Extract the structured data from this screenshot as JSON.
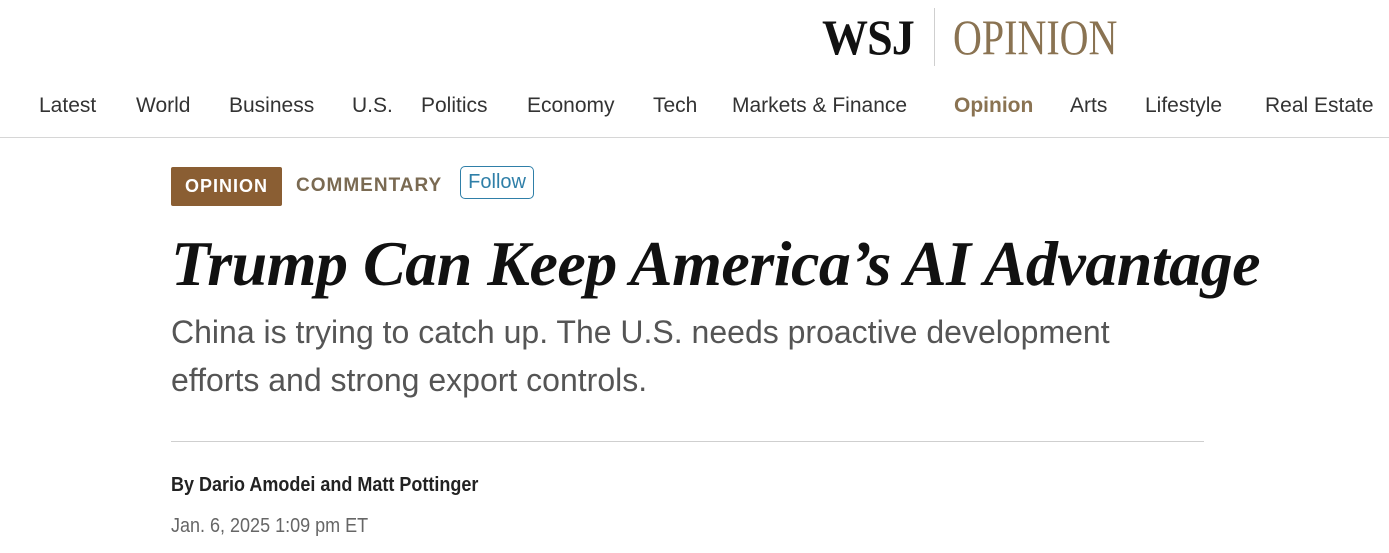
{
  "masthead": {
    "brand": "WSJ",
    "section": "OPINION"
  },
  "nav": {
    "items": [
      {
        "label": "Latest"
      },
      {
        "label": "World"
      },
      {
        "label": "Business"
      },
      {
        "label": "U.S."
      },
      {
        "label": "Politics"
      },
      {
        "label": "Economy"
      },
      {
        "label": "Tech"
      },
      {
        "label": "Markets & Finance"
      },
      {
        "label": "Opinion",
        "active": true
      },
      {
        "label": "Arts"
      },
      {
        "label": "Lifestyle"
      },
      {
        "label": "Real Estate"
      }
    ]
  },
  "article": {
    "section_badge": "OPINION",
    "column": "COMMENTARY",
    "follow_label": "Follow",
    "headline": "Trump Can Keep America’s AI Advantage",
    "dek": "China is trying to catch up. The U.S. needs proactive development efforts and strong export controls.",
    "byline": "By Dario Amodei and Matt Pottinger",
    "timestamp": "Jan. 6, 2025 1:09 pm ET"
  },
  "colors": {
    "opinion_accent": "#8a7352",
    "badge_background": "#8a5e33",
    "follow_blue": "#2f7fa8"
  }
}
